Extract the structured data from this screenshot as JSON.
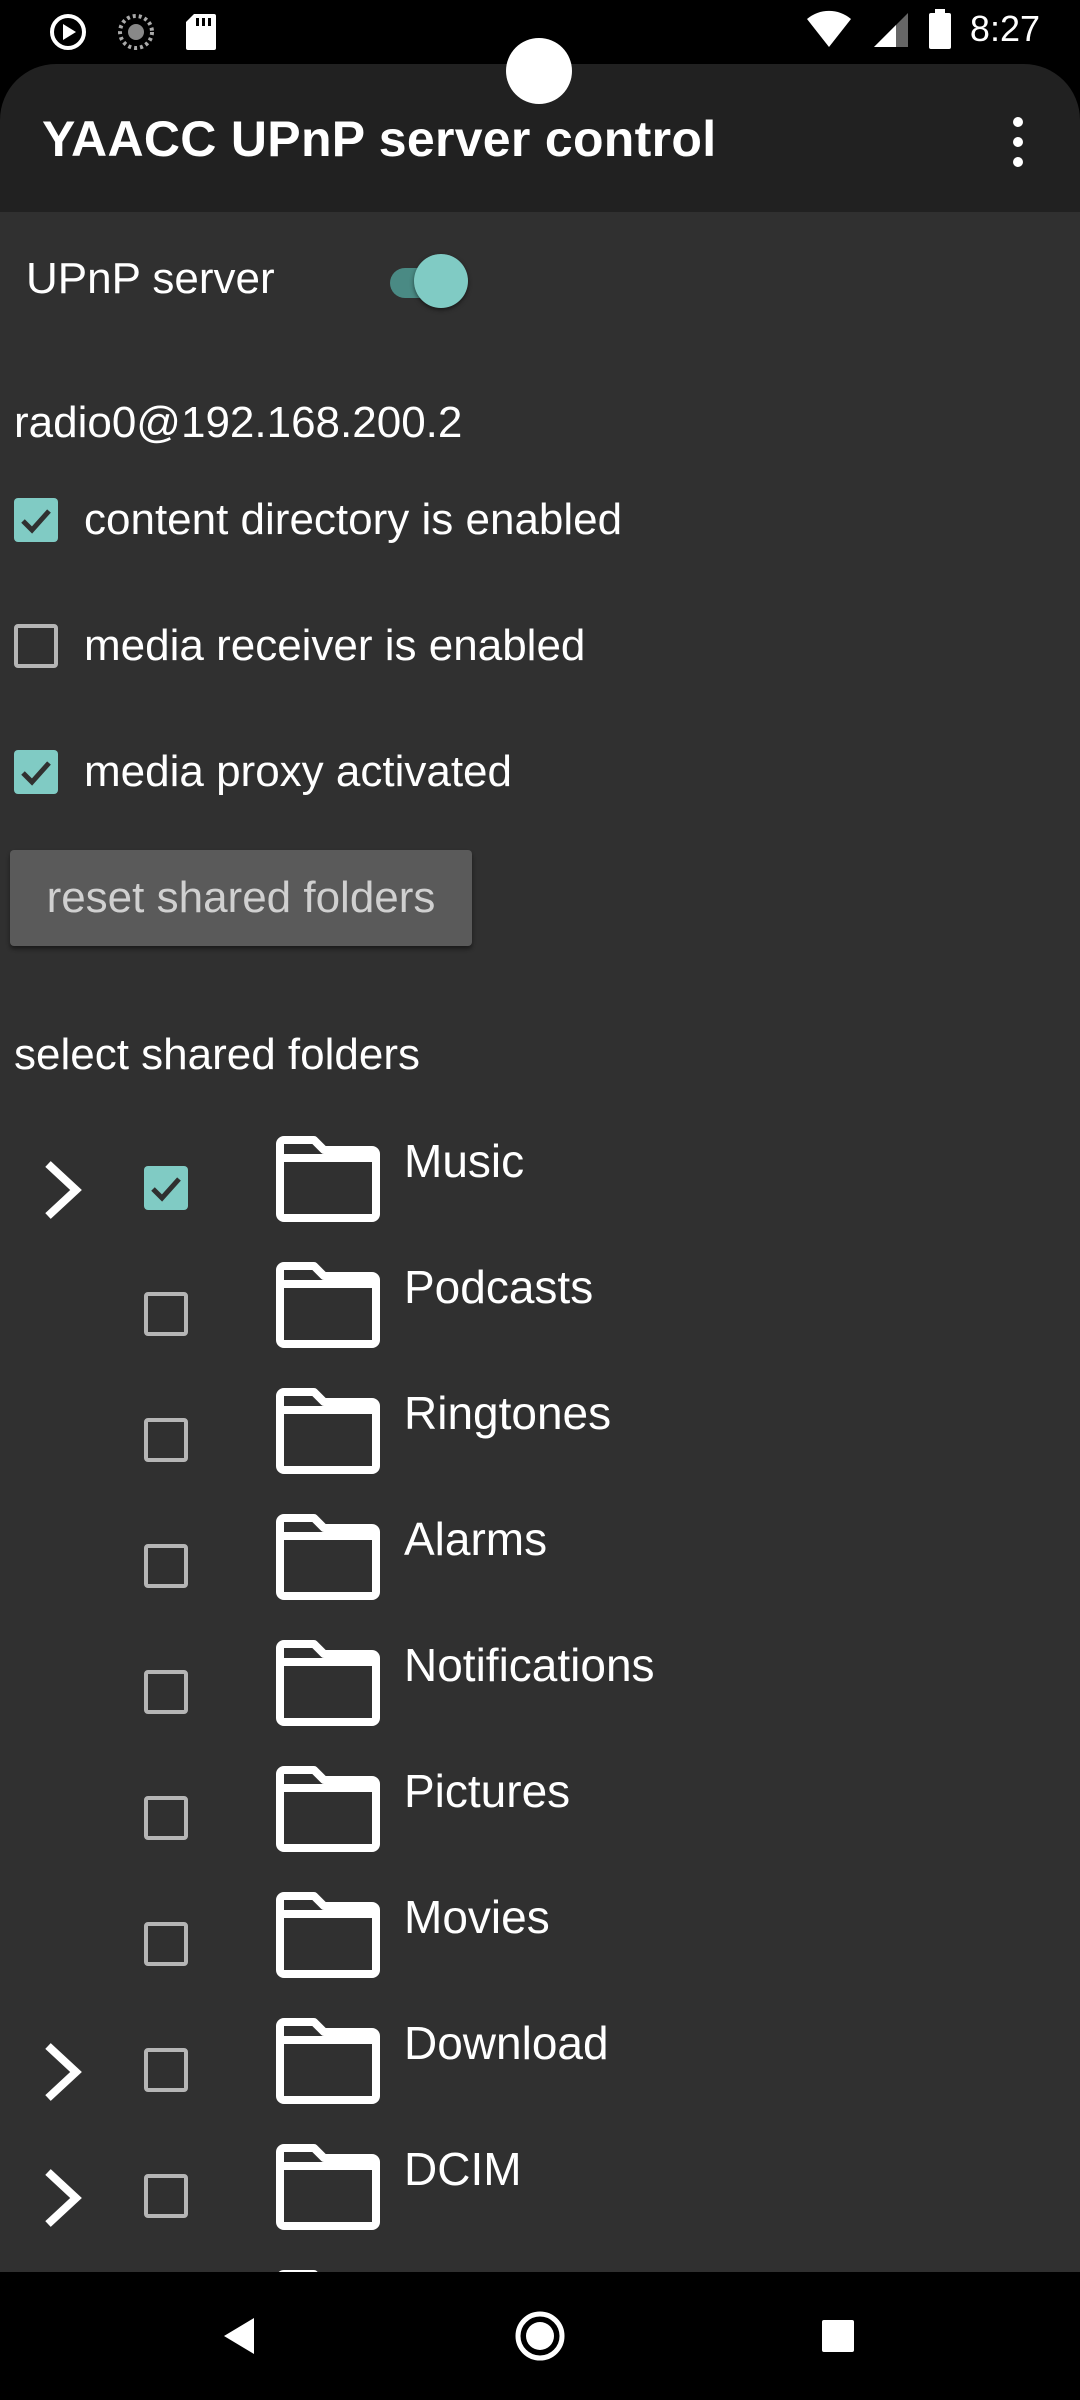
{
  "status_bar": {
    "time": "8:27",
    "left_icons": [
      "play-circle-icon",
      "loading-spinner-icon",
      "sd-card-icon"
    ],
    "right_icons": [
      "wifi-icon",
      "cell-signal-icon",
      "battery-icon"
    ]
  },
  "app_bar": {
    "title": "YAACC UPnP server control",
    "menu_icon": "overflow-menu-icon"
  },
  "server": {
    "label": "UPnP server",
    "enabled": true
  },
  "address": "radio0@192.168.200.2",
  "options": [
    {
      "label": "content directory is enabled",
      "checked": true
    },
    {
      "label": "media receiver is enabled",
      "checked": false
    },
    {
      "label": "media proxy activated",
      "checked": true
    }
  ],
  "reset_button": "reset shared folders",
  "shared_folders_label": "select shared folders",
  "folders": [
    {
      "name": "Music",
      "expandable": true,
      "checked": true
    },
    {
      "name": "Podcasts",
      "expandable": false,
      "checked": false
    },
    {
      "name": "Ringtones",
      "expandable": false,
      "checked": false
    },
    {
      "name": "Alarms",
      "expandable": false,
      "checked": false
    },
    {
      "name": "Notifications",
      "expandable": false,
      "checked": false
    },
    {
      "name": "Pictures",
      "expandable": false,
      "checked": false
    },
    {
      "name": "Movies",
      "expandable": false,
      "checked": false
    },
    {
      "name": "Download",
      "expandable": true,
      "checked": false
    },
    {
      "name": "DCIM",
      "expandable": true,
      "checked": false
    }
  ],
  "colors": {
    "accent": "#80cbc4",
    "background": "#303030",
    "app_bar": "#212121"
  },
  "nav_bar": {
    "buttons": [
      "back-icon",
      "home-icon",
      "recents-icon"
    ]
  }
}
